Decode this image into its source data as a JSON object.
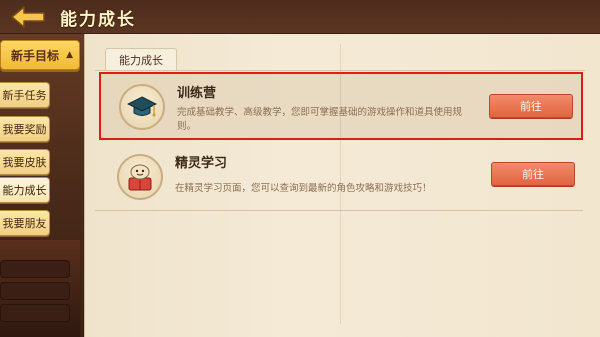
{
  "header": {
    "title": "能力成长"
  },
  "sidebar": {
    "section_label": "新手目标",
    "items": [
      {
        "label": "新手任务"
      },
      {
        "label": "我要奖励"
      },
      {
        "label": "我要皮肤"
      },
      {
        "label": "能力成长",
        "active": true
      },
      {
        "label": "我要朋友"
      }
    ]
  },
  "panel": {
    "tab": "能力成长",
    "rows": [
      {
        "title": "训练营",
        "desc": "完成基础教学、高级教学，您即可掌握基础的游戏操作和道具使用规则。",
        "button": "前往",
        "icon": "graduation-cap-icon"
      },
      {
        "title": "精灵学习",
        "desc": "在精灵学习页面，您可以查询到最新的角色攻略和游戏技巧！",
        "button": "前往",
        "icon": "spirit-book-icon"
      }
    ]
  },
  "colors": {
    "accent_button": "#e2653f",
    "highlight_border": "#e21a1a",
    "sidebar_header": "#f2b837"
  }
}
